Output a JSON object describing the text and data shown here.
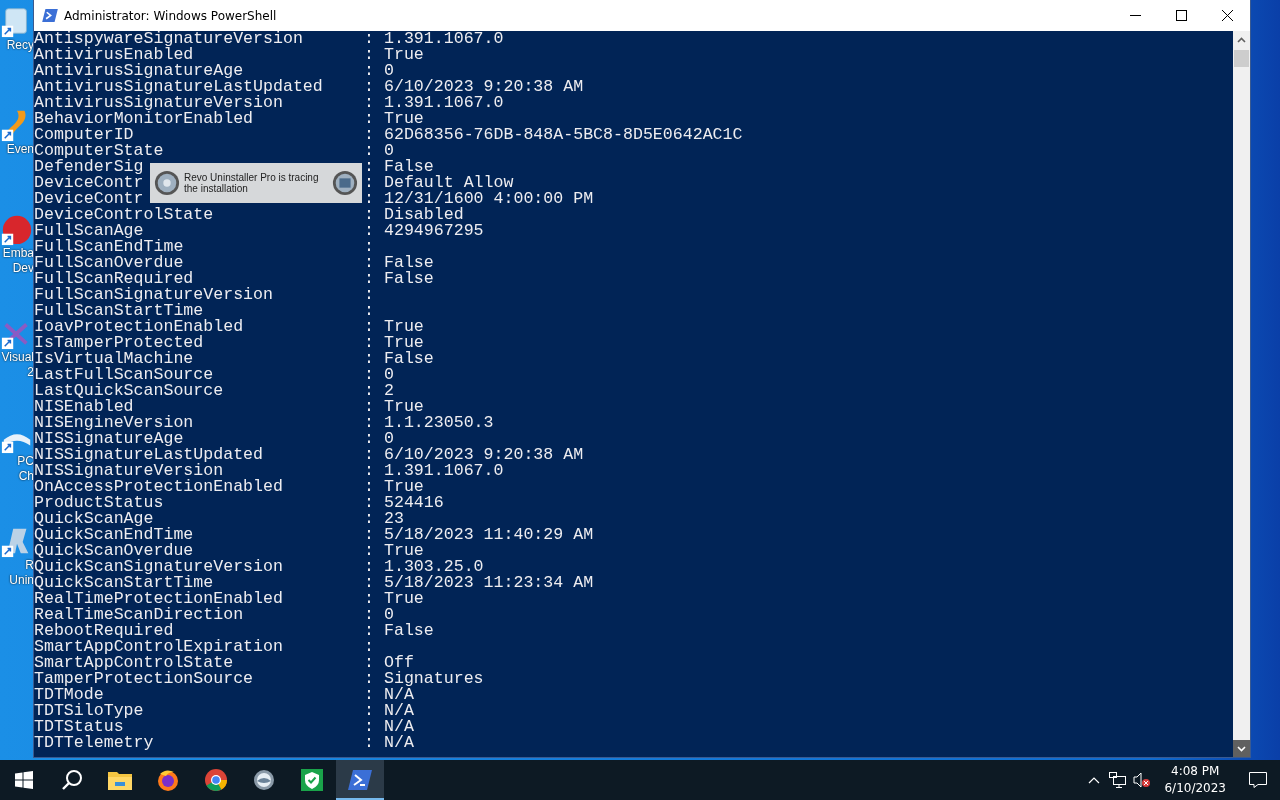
{
  "desktop_icons": [
    {
      "kind": "recycle",
      "label_lines": [
        "Recy"
      ]
    },
    {
      "kind": "events",
      "label_lines": [
        "Even"
      ]
    },
    {
      "kind": "embarcadero",
      "label_lines": [
        "Emba",
        "Dev"
      ]
    },
    {
      "kind": "visual",
      "label_lines": [
        "Visual",
        "2"
      ]
    },
    {
      "kind": "pc",
      "label_lines": [
        "PC",
        "Ch"
      ]
    },
    {
      "kind": "revo",
      "label_lines": [
        "R",
        "Unin"
      ]
    }
  ],
  "window": {
    "title": "Administrator: Windows PowerShell"
  },
  "console": {
    "rows": [
      {
        "name": "AntispywareSignatureVersion",
        "sep": ":",
        "value": "1.391.1067.0"
      },
      {
        "name": "AntivirusEnabled",
        "sep": ":",
        "value": "True"
      },
      {
        "name": "AntivirusSignatureAge",
        "sep": ":",
        "value": "0"
      },
      {
        "name": "AntivirusSignatureLastUpdated",
        "sep": ":",
        "value": "6/10/2023 9:20:38 AM"
      },
      {
        "name": "AntivirusSignatureVersion",
        "sep": ":",
        "value": "1.391.1067.0"
      },
      {
        "name": "BehaviorMonitorEnabled",
        "sep": ":",
        "value": "True"
      },
      {
        "name": "ComputerID",
        "sep": ":",
        "value": "62D68356-76DB-848A-5BC8-8D5E0642AC1C"
      },
      {
        "name": "ComputerState",
        "sep": ":",
        "value": "0"
      },
      {
        "name": "DefenderSig",
        "sep": ":",
        "value": "False"
      },
      {
        "name": "DeviceContr",
        "sep": ":",
        "value": "Default Allow"
      },
      {
        "name": "DeviceContr",
        "sep": ":",
        "value": "12/31/1600 4:00:00 PM"
      },
      {
        "name": "DeviceControlState",
        "sep": ":",
        "value": "Disabled"
      },
      {
        "name": "FullScanAge",
        "sep": ":",
        "value": "4294967295"
      },
      {
        "name": "FullScanEndTime",
        "sep": ":"
      },
      {
        "name": "FullScanOverdue",
        "sep": ":",
        "value": "False"
      },
      {
        "name": "FullScanRequired",
        "sep": ":",
        "value": "False"
      },
      {
        "name": "FullScanSignatureVersion",
        "sep": ":"
      },
      {
        "name": "FullScanStartTime",
        "sep": ":"
      },
      {
        "name": "IoavProtectionEnabled",
        "sep": ":",
        "value": "True"
      },
      {
        "name": "IsTamperProtected",
        "sep": ":",
        "value": "True"
      },
      {
        "name": "IsVirtualMachine",
        "sep": ":",
        "value": "False"
      },
      {
        "name": "LastFullScanSource",
        "sep": ":",
        "value": "0"
      },
      {
        "name": "LastQuickScanSource",
        "sep": ":",
        "value": "2"
      },
      {
        "name": "NISEnabled",
        "sep": ":",
        "value": "True"
      },
      {
        "name": "NISEngineVersion",
        "sep": ":",
        "value": "1.1.23050.3"
      },
      {
        "name": "NISSignatureAge",
        "sep": ":",
        "value": "0"
      },
      {
        "name": "NISSignatureLastUpdated",
        "sep": ":",
        "value": "6/10/2023 9:20:38 AM"
      },
      {
        "name": "NISSignatureVersion",
        "sep": ":",
        "value": "1.391.1067.0"
      },
      {
        "name": "OnAccessProtectionEnabled",
        "sep": ":",
        "value": "True"
      },
      {
        "name": "ProductStatus",
        "sep": ":",
        "value": "524416"
      },
      {
        "name": "QuickScanAge",
        "sep": ":",
        "value": "23"
      },
      {
        "name": "QuickScanEndTime",
        "sep": ":",
        "value": "5/18/2023 11:40:29 AM"
      },
      {
        "name": "QuickScanOverdue",
        "sep": ":",
        "value": "True"
      },
      {
        "name": "QuickScanSignatureVersion",
        "sep": ":",
        "value": "1.303.25.0"
      },
      {
        "name": "QuickScanStartTime",
        "sep": ":",
        "value": "5/18/2023 11:23:34 AM"
      },
      {
        "name": "RealTimeProtectionEnabled",
        "sep": ":",
        "value": "True"
      },
      {
        "name": "RealTimeScanDirection",
        "sep": ":",
        "value": "0"
      },
      {
        "name": "RebootRequired",
        "sep": ":",
        "value": "False"
      },
      {
        "name": "SmartAppControlExpiration",
        "sep": ":"
      },
      {
        "name": "SmartAppControlState",
        "sep": ":",
        "value": "Off"
      },
      {
        "name": "TamperProtectionSource",
        "sep": ":",
        "value": "Signatures"
      },
      {
        "name": "TDTMode",
        "sep": ":",
        "value": "N/A"
      },
      {
        "name": "TDTSiloType",
        "sep": ":",
        "value": "N/A"
      },
      {
        "name": "TDTStatus",
        "sep": ":",
        "value": "N/A"
      },
      {
        "name": "TDTTelemetry",
        "sep": ":",
        "value": "N/A"
      }
    ]
  },
  "popup": {
    "text": "Revo Uninstaller Pro is tracing the installation"
  },
  "taskbar": {
    "apps": [
      {
        "kind": "start",
        "selected": false
      },
      {
        "kind": "search",
        "selected": false
      },
      {
        "kind": "explorer",
        "selected": false
      },
      {
        "kind": "firefox",
        "selected": false
      },
      {
        "kind": "chrome",
        "selected": false
      },
      {
        "kind": "disc",
        "selected": false
      },
      {
        "kind": "shield",
        "selected": false
      },
      {
        "kind": "powershell",
        "selected": true
      }
    ]
  },
  "tray": {
    "time": "4:08 PM",
    "date": "6/10/2023"
  }
}
